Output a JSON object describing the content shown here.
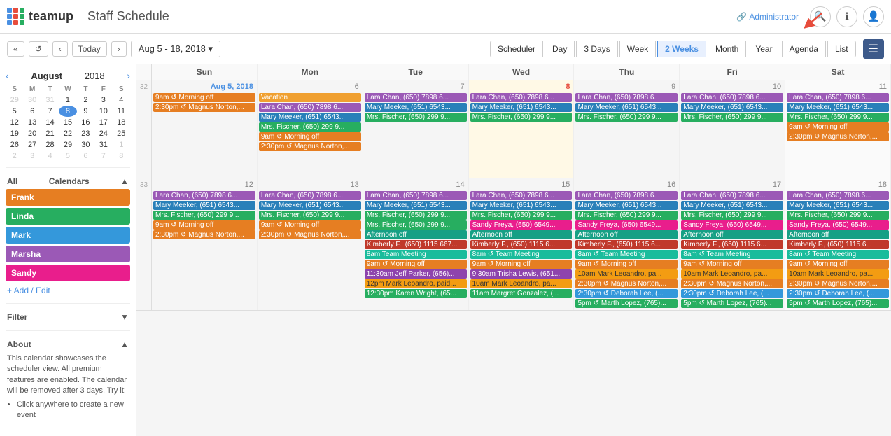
{
  "header": {
    "logo_text": "teamup",
    "title": "Staff Schedule",
    "admin_text": "Administrator",
    "search_icon": "🔍",
    "info_icon": "ℹ",
    "user_icon": "👤"
  },
  "toolbar": {
    "prev_prev": "«",
    "refresh": "↺",
    "prev": "‹",
    "today": "Today",
    "next": "›",
    "date_range": "Aug 5 - 18, 2018 ▾",
    "views": [
      "Scheduler",
      "Day",
      "3 Days",
      "Week",
      "2 Weeks",
      "Month",
      "Year",
      "Agenda",
      "List"
    ],
    "active_view": "2 Weeks"
  },
  "sidebar": {
    "mini_cal": {
      "month": "August",
      "year": "2018",
      "days_header": [
        "S",
        "M",
        "T",
        "W",
        "T",
        "F",
        "S"
      ],
      "weeks": [
        [
          {
            "n": "29",
            "other": true
          },
          {
            "n": "30",
            "other": true
          },
          {
            "n": "31",
            "other": true
          },
          {
            "n": "1"
          },
          {
            "n": "2"
          },
          {
            "n": "3"
          },
          {
            "n": "4"
          }
        ],
        [
          {
            "n": "5"
          },
          {
            "n": "6"
          },
          {
            "n": "7"
          },
          {
            "n": "8",
            "today": true
          },
          {
            "n": "9"
          },
          {
            "n": "10"
          },
          {
            "n": "11"
          }
        ],
        [
          {
            "n": "12"
          },
          {
            "n": "13"
          },
          {
            "n": "14"
          },
          {
            "n": "15"
          },
          {
            "n": "16"
          },
          {
            "n": "17"
          },
          {
            "n": "18"
          }
        ],
        [
          {
            "n": "19"
          },
          {
            "n": "20"
          },
          {
            "n": "21"
          },
          {
            "n": "22"
          },
          {
            "n": "23"
          },
          {
            "n": "24"
          },
          {
            "n": "25"
          }
        ],
        [
          {
            "n": "26"
          },
          {
            "n": "27"
          },
          {
            "n": "28"
          },
          {
            "n": "29"
          },
          {
            "n": "30"
          },
          {
            "n": "31"
          },
          {
            "n": "1",
            "other": true
          }
        ],
        [
          {
            "n": "2",
            "other": true
          },
          {
            "n": "3",
            "other": true
          },
          {
            "n": "4",
            "other": true
          },
          {
            "n": "5",
            "other": true
          },
          {
            "n": "6",
            "other": true
          },
          {
            "n": "7",
            "other": true
          },
          {
            "n": "8",
            "other": true
          }
        ]
      ]
    },
    "calendars_label": "Calendars",
    "calendars": [
      {
        "name": "Frank",
        "color": "#e67e22"
      },
      {
        "name": "Linda",
        "color": "#27ae60"
      },
      {
        "name": "Mark",
        "color": "#3498db"
      },
      {
        "name": "Marsha",
        "color": "#9b59b6"
      },
      {
        "name": "Sandy",
        "color": "#e91e8c"
      }
    ],
    "add_edit": "+ Add / Edit",
    "filter_label": "Filter",
    "about_label": "About",
    "about_text": "This calendar showcases the scheduler view. All premium features are enabled. The calendar will be removed after 3 days. Try it:",
    "about_bullets": [
      "Click anywhere to create a new event"
    ]
  },
  "calendar": {
    "week_days": [
      "Sun",
      "Mon",
      "Tue",
      "Wed",
      "Thu",
      "Fri",
      "Sat"
    ],
    "week1": {
      "week_num": "32",
      "days": [
        {
          "num": "Aug 5, 2018",
          "num_display": "Aug 5, 2018",
          "today": false,
          "blue": true,
          "events": []
        },
        {
          "num": "6",
          "events": [
            {
              "text": "Vacation",
              "color": "orange",
              "full": true
            }
          ]
        },
        {
          "num": "7",
          "events": []
        },
        {
          "num": "8",
          "events": []
        },
        {
          "num": "9",
          "events": []
        },
        {
          "num": "10",
          "events": []
        },
        {
          "num": "11",
          "events": []
        }
      ]
    }
  },
  "colors": {
    "accent": "#4a90e2",
    "today_bg": "#fff9e6",
    "arrow_color": "#e74c3c"
  }
}
